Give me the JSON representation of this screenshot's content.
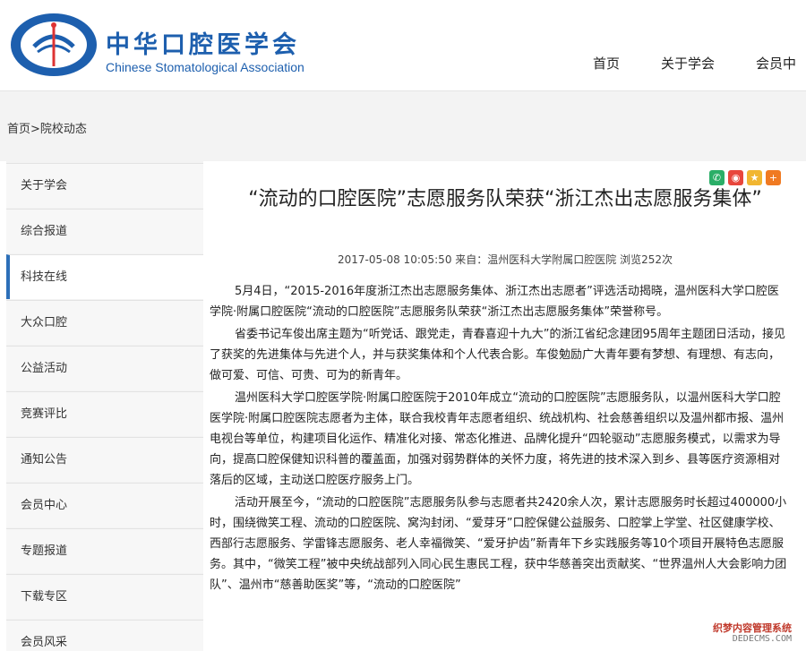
{
  "header": {
    "brand_cn": "中华口腔医学会",
    "brand_en": "Chinese Stomatological Association",
    "logo_text_cn": "中华口腔医学会",
    "logo_text_en": "Chinese Stomatological Association",
    "brand_color": "#1d5fae",
    "nav": [
      "首页",
      "关于学会",
      "会员中"
    ]
  },
  "breadcrumb": {
    "home": "首页",
    "sep": ">",
    "current": "院校动态"
  },
  "sidebar": {
    "active_color": "#2c6fb8",
    "items": [
      {
        "label": "关于学会"
      },
      {
        "label": "综合报道"
      },
      {
        "label": "科技在线",
        "active": true
      },
      {
        "label": "大众口腔"
      },
      {
        "label": "公益活动"
      },
      {
        "label": "竞赛评比"
      },
      {
        "label": "通知公告"
      },
      {
        "label": "会员中心"
      },
      {
        "label": "专题报道"
      },
      {
        "label": "下载专区"
      },
      {
        "label": "会员风采"
      }
    ]
  },
  "share": {
    "icons": [
      "wechat-icon",
      "weibo-icon",
      "qzone-icon",
      "plus-icon"
    ]
  },
  "article": {
    "title": "“流动的口腔医院”志愿服务队荣获“浙江杰出志愿服务集体”",
    "meta": "2017-05-08 10:05:50 来自：温州医科大学附属口腔医院 浏览252次",
    "paragraphs": [
      "5月4日，“2015-2016年度浙江杰出志愿服务集体、浙江杰出志愿者”评选活动揭晓，温州医科大学口腔医学院·附属口腔医院“流动的口腔医院”志愿服务队荣获“浙江杰出志愿服务集体”荣誉称号。",
      "省委书记车俊出席主题为“听党话、跟党走，青春喜迎十九大”的浙江省纪念建团95周年主题团日活动，接见了获奖的先进集体与先进个人，并与获奖集体和个人代表合影。车俊勉励广大青年要有梦想、有理想、有志向，做可爱、可信、可贵、可为的新青年。",
      "温州医科大学口腔医学院·附属口腔医院于2010年成立“流动的口腔医院”志愿服务队，以温州医科大学口腔医学院·附属口腔医院志愿者为主体，联合我校青年志愿者组织、统战机构、社会慈善组织以及温州都市报、温州电视台等单位，构建项目化运作、精准化对接、常态化推进、品牌化提升“四轮驱动”志愿服务模式，以需求为导向，提高口腔保健知识科普的覆盖面，加强对弱势群体的关怀力度，将先进的技术深入到乡、县等医疗资源相对落后的区域，主动送口腔医疗服务上门。",
      "活动开展至今，“流动的口腔医院”志愿服务队参与志愿者共2420余人次，累计志愿服务时长超过400000小时，围绕微笑工程、流动的口腔医院、窝沟封闭、“爱芽牙”口腔保健公益服务、口腔掌上学堂、社区健康学校、西部行志愿服务、学雷锋志愿服务、老人幸福微笑、“爱牙护齿”新青年下乡实践服务等10个项目开展特色志愿服务。其中，“微笑工程”被中央统战部列入同心民生惠民工程，获中华慈善突出贡献奖、“世界温州人大会影响力团队”、温州市“慈善助医奖”等，“流动的口腔医院”"
    ]
  },
  "watermark": {
    "cn": "织梦内容管理系统",
    "en": "DEDECMS.COM"
  }
}
